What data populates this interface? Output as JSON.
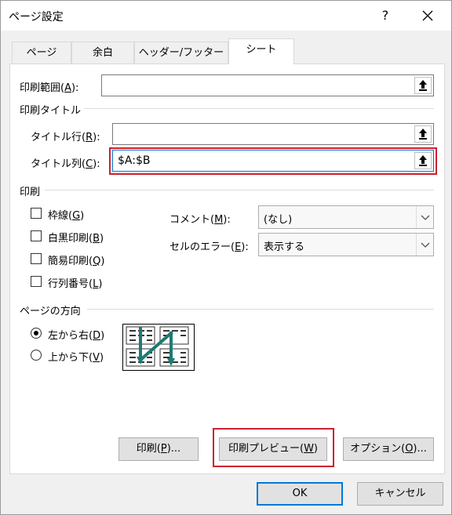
{
  "window": {
    "title": "ページ設定",
    "help_symbol": "?"
  },
  "tabs": [
    {
      "label": "ページ"
    },
    {
      "label": "余白"
    },
    {
      "label": "ヘッダー/フッター"
    },
    {
      "label": "シート",
      "active": true
    }
  ],
  "print_area": {
    "label_pre": "印刷範囲(",
    "key": "A",
    "label_post": "):",
    "value": ""
  },
  "print_titles": {
    "heading": "印刷タイトル",
    "rows": {
      "label_pre": "タイトル行(",
      "key": "R",
      "label_post": "):",
      "value": ""
    },
    "cols": {
      "label_pre": "タイトル列(",
      "key": "C",
      "label_post": "):",
      "value": "$A:$B"
    }
  },
  "print": {
    "heading": "印刷",
    "gridlines": {
      "label_pre": "枠線(",
      "key": "G",
      "label_post": ")",
      "checked": false
    },
    "black_white": {
      "label_pre": "白黒印刷(",
      "key": "B",
      "label_post": ")",
      "checked": false
    },
    "draft": {
      "label_pre": "簡易印刷(",
      "key": "Q",
      "label_post": ")",
      "checked": false
    },
    "headings": {
      "label_pre": "行列番号(",
      "key": "L",
      "label_post": ")",
      "checked": false
    },
    "comments": {
      "label_pre": "コメント(",
      "key": "M",
      "label_post": "):",
      "value": "(なし)"
    },
    "errors": {
      "label_pre": "セルのエラー(",
      "key": "E",
      "label_post": "):",
      "value": "表示する"
    }
  },
  "page_order": {
    "heading": "ページの方向",
    "down_then_over": {
      "label_pre": "左から右(",
      "key": "D",
      "label_post": ")",
      "selected": true
    },
    "over_then_down": {
      "label_pre": "上から下(",
      "key": "V",
      "label_post": ")",
      "selected": false
    }
  },
  "panel_buttons": {
    "print": {
      "label_pre": "印刷(",
      "key": "P",
      "label_post": ")..."
    },
    "preview": {
      "label_pre": "印刷プレビュー(",
      "key": "W",
      "label_post": ")"
    },
    "options": {
      "label_pre": "オプション(",
      "key": "O",
      "label_post": ")..."
    }
  },
  "footer": {
    "ok": "OK",
    "cancel": "キャンセル"
  },
  "colors": {
    "highlight": "#cc1f2e",
    "accent": "#0078d7",
    "diagram_arrow": "#1f7a72"
  }
}
